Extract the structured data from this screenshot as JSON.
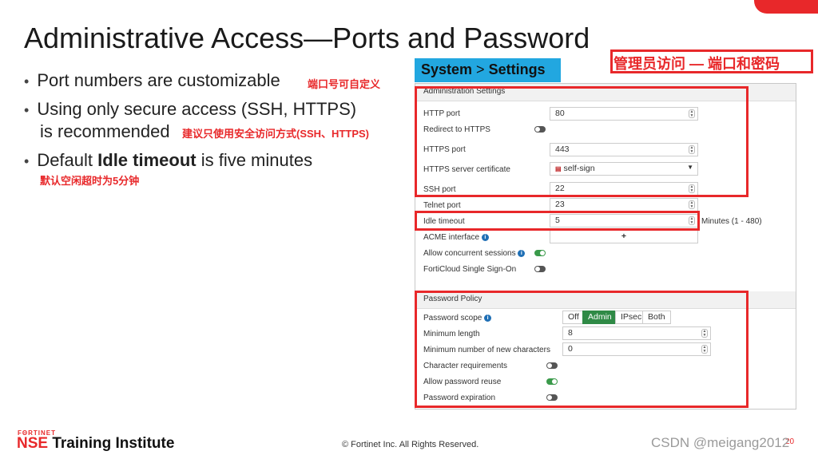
{
  "slide": {
    "title": "Administrative Access—Ports and Password",
    "bullets": [
      {
        "text": "Port numbers are customizable",
        "note": "端口号可自定义"
      },
      {
        "line1": "Using only secure access (SSH, HTTPS)",
        "line2": "is recommended",
        "note": "建议只使用安全访问方式(SSH、HTTPS)"
      },
      {
        "prefix": "Default ",
        "bold": "Idle timeout",
        "suffix": " is five minutes",
        "note": "默认空闲超时为5分钟"
      }
    ],
    "top_note": "管理员访问 — 端口和密码",
    "copyright": "© Fortinet Inc. All Rights Reserved.",
    "watermark": "CSDN @meigang2012",
    "page_number": "20",
    "logo": {
      "small": "FΘRTINET",
      "nse": "NSE",
      "rest": " Training Institute"
    }
  },
  "breadcrumb": {
    "system": "System",
    "sep": " > ",
    "settings": "Settings"
  },
  "admin_settings": {
    "heading": "Administration Settings",
    "http_port": {
      "label": "HTTP port",
      "value": "80"
    },
    "redirect": {
      "label": "Redirect to HTTPS",
      "enabled": false
    },
    "https_port": {
      "label": "HTTPS port",
      "value": "443"
    },
    "cert": {
      "label": "HTTPS server certificate",
      "value": "self-sign"
    },
    "ssh_port": {
      "label": "SSH port",
      "value": "22"
    },
    "telnet_port": {
      "label": "Telnet port",
      "value": "23"
    },
    "idle_timeout": {
      "label": "Idle timeout",
      "value": "5",
      "unit": "Minutes (1 - 480)"
    },
    "acme": {
      "label": "ACME interface",
      "add": "+"
    },
    "concurrent": {
      "label": "Allow concurrent sessions",
      "enabled": true
    },
    "forticloud": {
      "label": "FortiCloud Single Sign-On",
      "enabled": false
    }
  },
  "password_policy": {
    "heading": "Password Policy",
    "scope": {
      "label": "Password scope",
      "options": [
        "Off",
        "Admin",
        "IPsec",
        "Both"
      ],
      "selected": "Admin"
    },
    "min_length": {
      "label": "Minimum length",
      "value": "8"
    },
    "min_new_chars": {
      "label": "Minimum number of new characters",
      "value": "0"
    },
    "char_req": {
      "label": "Character requirements",
      "enabled": false
    },
    "reuse": {
      "label": "Allow password reuse",
      "enabled": true
    },
    "expiration": {
      "label": "Password expiration",
      "enabled": false
    }
  },
  "colors": {
    "accent_red": "#e8282a",
    "breadcrumb_bg": "#22a7e0",
    "toggle_on": "#3a9a4a",
    "scope_active": "#2f8a46"
  }
}
